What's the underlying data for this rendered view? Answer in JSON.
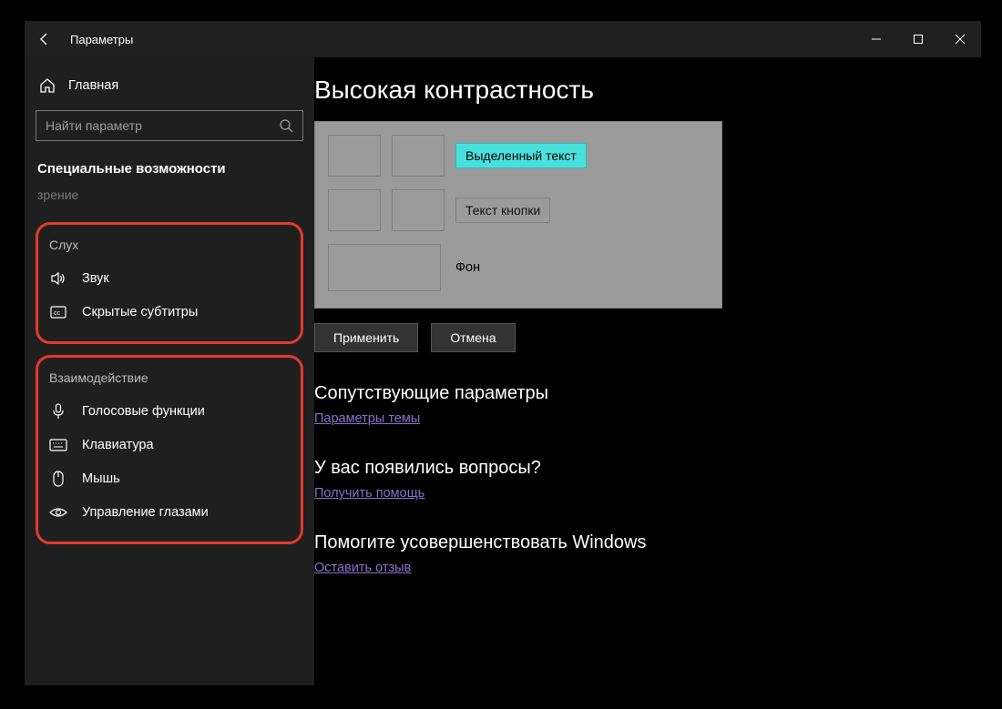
{
  "window": {
    "title": "Параметры"
  },
  "sidebar": {
    "home": "Главная",
    "search_placeholder": "Найти параметр",
    "section": "Специальные возможности",
    "faded": "зрение",
    "group_hearing": {
      "label": "Слух",
      "items": [
        {
          "label": "Звук"
        },
        {
          "label": "Скрытые субтитры"
        }
      ]
    },
    "group_interaction": {
      "label": "Взаимодействие",
      "items": [
        {
          "label": "Голосовые функции"
        },
        {
          "label": "Клавиатура"
        },
        {
          "label": "Мышь"
        },
        {
          "label": "Управление глазами"
        }
      ]
    }
  },
  "main": {
    "title": "Высокая контрастность",
    "preview": {
      "highlighted_text": "Выделенный текст",
      "button_text": "Текст кнопки",
      "background": "Фон"
    },
    "apply": "Применить",
    "cancel": "Отмена",
    "related_heading": "Сопутствующие параметры",
    "related_link": "Параметры темы",
    "questions_heading": "У вас появились вопросы?",
    "questions_link": "Получить помощь",
    "feedback_heading": "Помогите усовершенствовать Windows",
    "feedback_link": "Оставить отзыв"
  }
}
